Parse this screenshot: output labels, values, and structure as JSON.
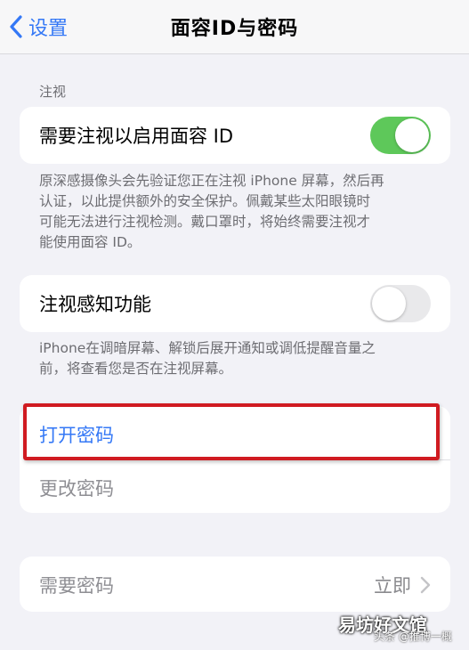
{
  "nav": {
    "back_label": "设置",
    "title": "面容ID与密码"
  },
  "attention": {
    "header": "注视",
    "require_attention_label": "需要注视以启用面容 ID",
    "require_attention_on": true,
    "require_attention_footer": "原深感摄像头会先验证您正在注视 iPhone 屏幕，然后再\n认证，以此提供额外的安全保护。佩戴某些太阳眼镜时\n可能无法进行注视检测。戴口罩时，将始终需要注视才\n能使用面容 ID。",
    "aware_label": "注视感知功能",
    "aware_on": false,
    "aware_footer": "iPhone在调暗屏幕、解锁后展开通知或调低提醒音量之\n前，将查看您是否在注视屏幕。"
  },
  "passcode": {
    "turn_on_label": "打开密码",
    "change_label": "更改密码"
  },
  "require": {
    "label": "需要密码",
    "value": "立即"
  },
  "watermark": {
    "site": "易坊好文馆",
    "credit": "头条 @推博一概"
  },
  "colors": {
    "accent": "#3478f6",
    "toggle_on": "#5ec85a",
    "highlight": "#d01b21"
  }
}
